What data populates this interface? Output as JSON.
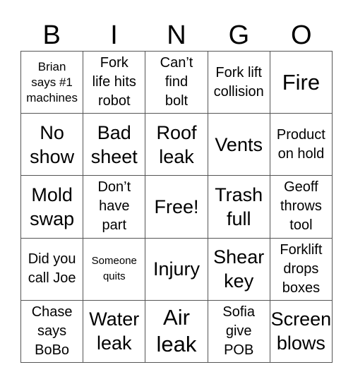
{
  "header": {
    "letters": [
      "B",
      "I",
      "N",
      "G",
      "O"
    ]
  },
  "card": {
    "cells": [
      {
        "text": "Brian\nsays #1\nmachines",
        "size": "s-s"
      },
      {
        "text": "Fork\nlife hits\nrobot",
        "size": "s-m"
      },
      {
        "text": "Can’t\nfind\nbolt",
        "size": "s-m"
      },
      {
        "text": "Fork lift\ncollision",
        "size": "s-m"
      },
      {
        "text": "Fire",
        "size": "s-xl"
      },
      {
        "text": "No\nshow",
        "size": "s-l"
      },
      {
        "text": "Bad\nsheet",
        "size": "s-l"
      },
      {
        "text": "Roof\nleak",
        "size": "s-l"
      },
      {
        "text": "Vents",
        "size": "s-l"
      },
      {
        "text": "Product\non hold",
        "size": "s-m"
      },
      {
        "text": "Mold\nswap",
        "size": "s-l"
      },
      {
        "text": "Don’t\nhave\npart",
        "size": "s-m"
      },
      {
        "text": "Free!",
        "size": "s-l"
      },
      {
        "text": "Trash\nfull",
        "size": "s-l"
      },
      {
        "text": "Geoff\nthrows\ntool",
        "size": "s-m"
      },
      {
        "text": "Did you\ncall Joe",
        "size": "s-m"
      },
      {
        "text": "Someone\nquits",
        "size": "s-xs"
      },
      {
        "text": "Injury",
        "size": "s-l"
      },
      {
        "text": "Shear\nkey",
        "size": "s-l"
      },
      {
        "text": "Forklift\ndrops\nboxes",
        "size": "s-m"
      },
      {
        "text": "Chase\nsays\nBoBo",
        "size": "s-m"
      },
      {
        "text": "Water\nleak",
        "size": "s-l"
      },
      {
        "text": "Air\nleak",
        "size": "s-xl"
      },
      {
        "text": "Sofia\ngive\nPOB",
        "size": "s-m"
      },
      {
        "text": "Screen\nblows",
        "size": "s-l"
      }
    ]
  }
}
